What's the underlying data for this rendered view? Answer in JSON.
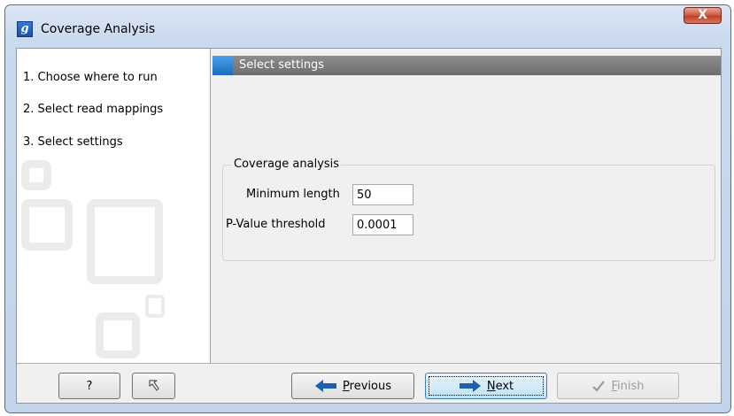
{
  "window": {
    "title": "Coverage Analysis",
    "app_icon_letter": "g",
    "close_glyph": "X"
  },
  "steps": [
    {
      "number": "1.",
      "label": "Choose where to run"
    },
    {
      "number": "2.",
      "label": "Select read mappings"
    },
    {
      "number": "3.",
      "label": "Select settings"
    }
  ],
  "panel": {
    "header": "Select settings",
    "group_title": "Coverage analysis",
    "fields": [
      {
        "label": "Minimum length",
        "value": "50"
      },
      {
        "label": "P-Value threshold",
        "value": "0.0001"
      }
    ]
  },
  "buttons": {
    "help_glyph": "?",
    "reset_icon": "reset-arrow-icon",
    "previous_label": "Previous",
    "previous_mnemonic": "P",
    "previous_rest": "revious",
    "next_mnemonic": "N",
    "next_rest": "ext",
    "finish_mnemonic": "F",
    "finish_rest": "inish"
  },
  "colors": {
    "header_accent": "#1a6cc0",
    "arrow_blue": "#1e5fb0",
    "close_red": "#c0402a"
  }
}
